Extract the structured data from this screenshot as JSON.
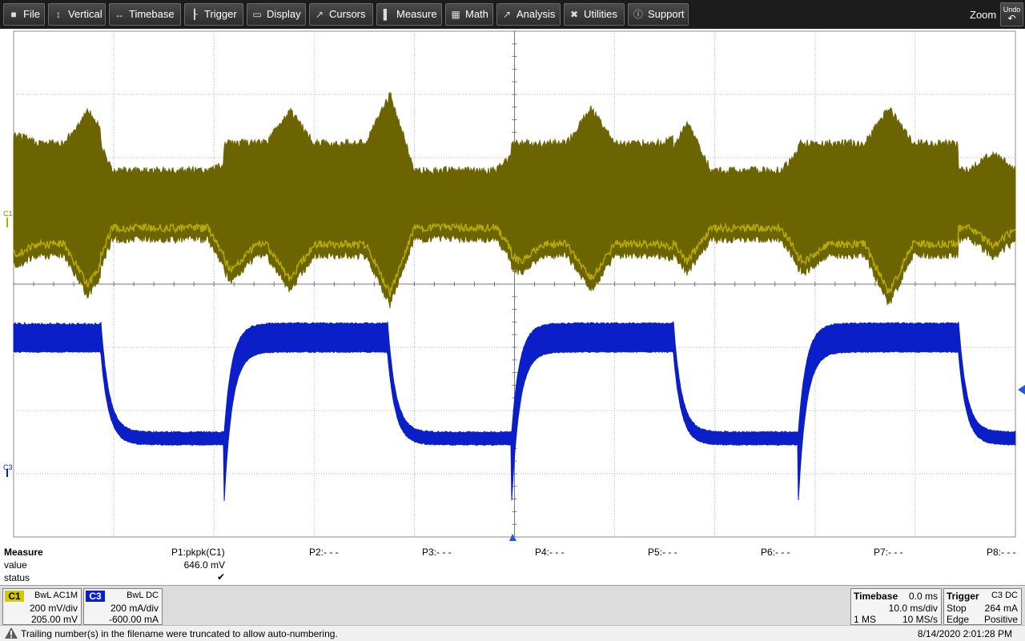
{
  "menu": {
    "items": [
      {
        "label": "File",
        "icon": "file-icon",
        "glyph": "■"
      },
      {
        "label": "Vertical",
        "icon": "vertical-arrows-icon",
        "glyph": "↕"
      },
      {
        "label": "Timebase",
        "icon": "horizontal-arrows-icon",
        "glyph": "↔"
      },
      {
        "label": "Trigger",
        "icon": "trigger-icon",
        "glyph": "┠"
      },
      {
        "label": "Display",
        "icon": "display-icon",
        "glyph": "▭"
      },
      {
        "label": "Cursors",
        "icon": "cursor-icon",
        "glyph": "↗"
      },
      {
        "label": "Measure",
        "icon": "measure-icon",
        "glyph": "▌"
      },
      {
        "label": "Math",
        "icon": "calculator-icon",
        "glyph": "▦"
      },
      {
        "label": "Analysis",
        "icon": "analysis-chart-icon",
        "glyph": "↗"
      },
      {
        "label": "Utilities",
        "icon": "tools-icon",
        "glyph": "✖"
      },
      {
        "label": "Support",
        "icon": "info-icon",
        "glyph": "ⓘ"
      }
    ],
    "zoom_label": "Zoom",
    "undo_label": "Undo"
  },
  "colors": {
    "c1": "#6b6400",
    "c1_edge": "#c8bd00",
    "c3": "#0a1fc8",
    "grid": "#b4b4b4",
    "marker": "#1e5bd6"
  },
  "channels": {
    "c1": {
      "marker": "C1"
    },
    "c3": {
      "marker": "C3"
    }
  },
  "measure": {
    "title": "Measure",
    "row_labels": [
      "value",
      "status"
    ],
    "params": [
      {
        "label": "P1:pkpk(C1)",
        "value": "646.0 mV",
        "status": "✔"
      },
      {
        "label": "P2:- - -",
        "value": "",
        "status": ""
      },
      {
        "label": "P3:- - -",
        "value": "",
        "status": ""
      },
      {
        "label": "P4:- - -",
        "value": "",
        "status": ""
      },
      {
        "label": "P5:- - -",
        "value": "",
        "status": ""
      },
      {
        "label": "P6:- - -",
        "value": "",
        "status": ""
      },
      {
        "label": "P7:- - -",
        "value": "",
        "status": ""
      },
      {
        "label": "P8:- - -",
        "value": "",
        "status": ""
      }
    ]
  },
  "descriptors": {
    "c1": {
      "badge": "C1",
      "coupling": "BwL AC1M",
      "scale": "200 mV/div",
      "offset": "205.00 mV"
    },
    "c3": {
      "badge": "C3",
      "coupling": "BwL DC",
      "scale": "200 mA/div",
      "offset": "-600.00 mA"
    },
    "timebase": {
      "title": "Timebase",
      "delay": "0.0 ms",
      "scale": "10.0 ms/div",
      "points": "1 MS",
      "rate": "10 MS/s"
    },
    "trigger": {
      "title": "Trigger",
      "source": "C3 DC",
      "mode": "Stop",
      "level": "264 mA",
      "type": "Edge",
      "slope": "Positive"
    }
  },
  "status": {
    "message": "Trailing number(s) in the filename were truncated to allow auto-numbering.",
    "datetime": "8/14/2020 2:01:28 PM"
  }
}
